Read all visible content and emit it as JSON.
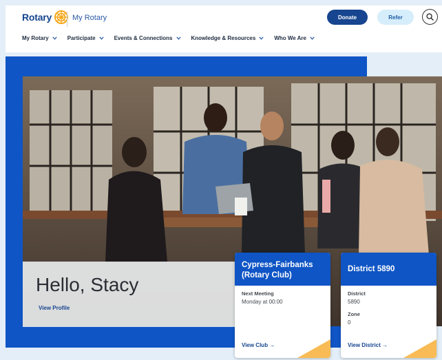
{
  "header": {
    "logo_text": "Rotary",
    "site_name": "My Rotary",
    "donate_label": "Donate",
    "refer_label": "Refer",
    "search_icon": "search-icon"
  },
  "nav": {
    "items": [
      {
        "label": "My Rotary"
      },
      {
        "label": "Participate"
      },
      {
        "label": "Events & Connections"
      },
      {
        "label": "Knowledge & Resources"
      },
      {
        "label": "Who We Are"
      }
    ]
  },
  "hero": {
    "greeting": "Hello, Stacy",
    "view_profile": "View Profile"
  },
  "cards": {
    "club": {
      "title": "Cypress-Fairbanks (Rotary Club)",
      "meeting_label": "Next Meeting",
      "meeting_value": "Monday at 00:00",
      "link": "View Club →"
    },
    "district": {
      "title": "District 5890",
      "district_label": "District",
      "district_value": "5890",
      "zone_label": "Zone",
      "zone_value": "0",
      "link": "View District →"
    }
  },
  "colors": {
    "brand_blue": "#17458f",
    "band_blue": "#0f55c5",
    "gold": "#f7a81b",
    "refer_bg": "#d6eefb"
  }
}
